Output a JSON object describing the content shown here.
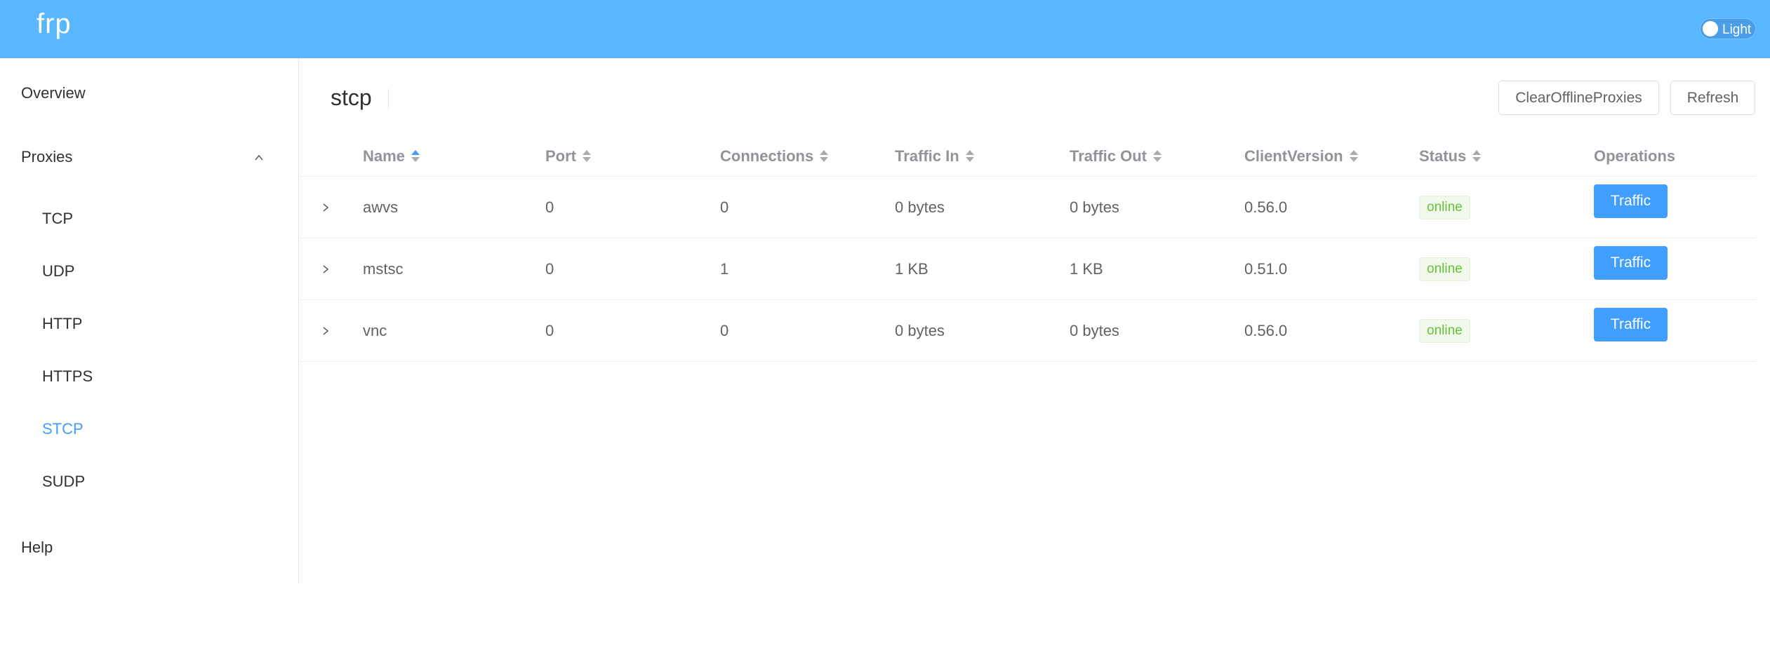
{
  "header": {
    "brand": "frp",
    "theme_label": "Light"
  },
  "sidebar": {
    "overview": "Overview",
    "proxies": "Proxies",
    "sub_items": [
      "TCP",
      "UDP",
      "HTTP",
      "HTTPS",
      "STCP",
      "SUDP"
    ],
    "active_item": "STCP",
    "help": "Help"
  },
  "content": {
    "title": "stcp",
    "clear_button": "ClearOfflineProxies",
    "refresh_button": "Refresh"
  },
  "table": {
    "columns": [
      "Name",
      "Port",
      "Connections",
      "Traffic In",
      "Traffic Out",
      "ClientVersion",
      "Status",
      "Operations"
    ],
    "rows": [
      {
        "name": "awvs",
        "port": "0",
        "connections": "0",
        "traffic_in": "0 bytes",
        "traffic_out": "0 bytes",
        "client_version": "0.56.0",
        "status": "online",
        "operation": "Traffic"
      },
      {
        "name": "mstsc",
        "port": "0",
        "connections": "1",
        "traffic_in": "1 KB",
        "traffic_out": "1 KB",
        "client_version": "0.51.0",
        "status": "online",
        "operation": "Traffic"
      },
      {
        "name": "vnc",
        "port": "0",
        "connections": "0",
        "traffic_in": "0 bytes",
        "traffic_out": "0 bytes",
        "client_version": "0.56.0",
        "status": "online",
        "operation": "Traffic"
      }
    ]
  },
  "colors": {
    "header_bg": "#58b7ff",
    "accent": "#409eff",
    "online": "#67c23a"
  }
}
